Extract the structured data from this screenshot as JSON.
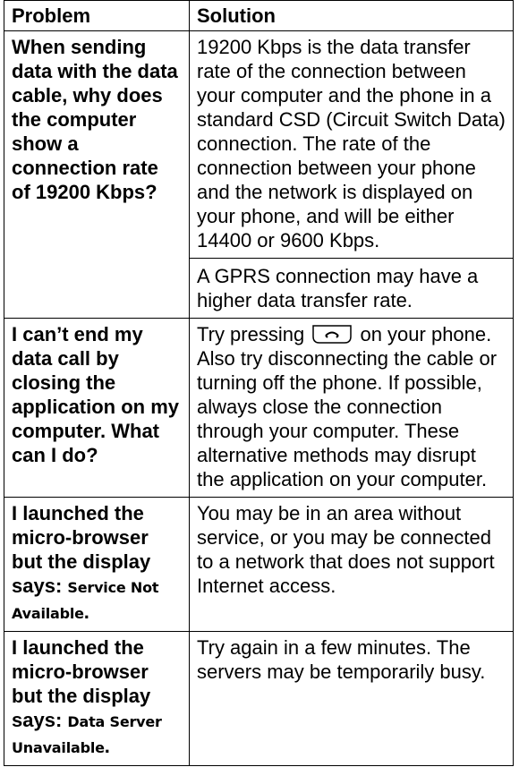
{
  "header": {
    "problem": "Problem",
    "solution": "Solution"
  },
  "rows": [
    {
      "problem": "When sending data with the data cable, why does the computer show a connection rate of 19200 Kbps?",
      "solution_1": "19200 Kbps is the data transfer rate of the connection between your computer and the phone in a standard CSD (Circuit Switch Data) connection. The rate of the connection between your phone and the network is displayed on your phone, and will be either 14400 or 9600 Kbps.",
      "solution_2": "A GPRS connection may have a higher data transfer rate."
    },
    {
      "problem": "I can’t end my data call by closing the application on my computer. What can I do?",
      "solution_before": "Try pressing",
      "solution_after": "on your phone. Also try disconnecting the cable or turning off the phone. If possible, always close the connection through your computer. These alternative methods may disrupt the application on your computer.",
      "key_icon": "end-key-icon"
    },
    {
      "problem": "I launched the micro-browser but the display says:",
      "display_text": "Service Not Available",
      "solution": "You may be in an area without service, or you may be connected to a network that does not support Internet access."
    },
    {
      "problem": "I launched the micro-browser but the display says:",
      "display_text": "Data Server Unavailable",
      "solution": "Try again in a few minutes. The servers may be temporarily busy."
    }
  ]
}
